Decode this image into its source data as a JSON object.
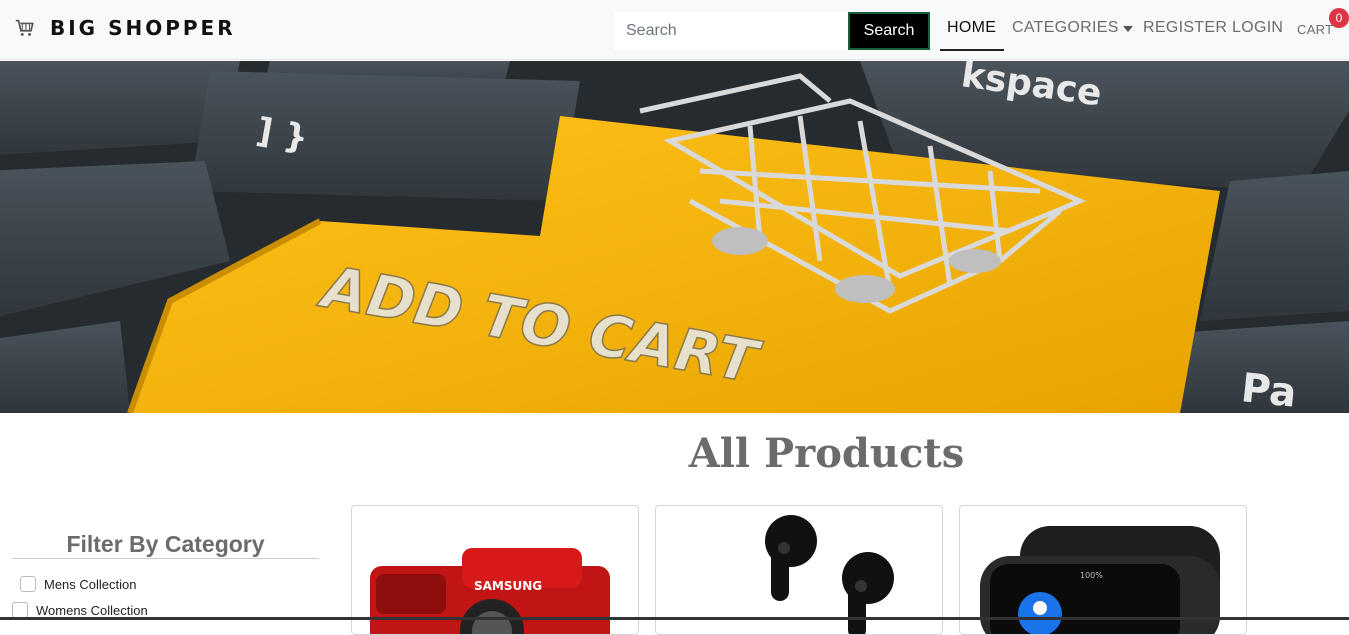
{
  "navbar": {
    "brand": "BIG SHOPPER",
    "search_placeholder": "Search",
    "search_button": "Search",
    "links": {
      "home": "HOME",
      "categories": "CATEGORIES",
      "register": "REGISTER",
      "login": "LOGIN",
      "cart": "CART"
    },
    "cart_count": "0"
  },
  "hero": {
    "key_text": "ADD TO CART",
    "accent_color": "#f5b400"
  },
  "main": {
    "title": "All Products"
  },
  "filter": {
    "title": "Filter By Category",
    "items": [
      "Mens Collection",
      "Womens Collection"
    ]
  },
  "products": [
    {
      "image": "camera-image"
    },
    {
      "image": "earbuds-image"
    },
    {
      "image": "smartwatch-image"
    }
  ]
}
